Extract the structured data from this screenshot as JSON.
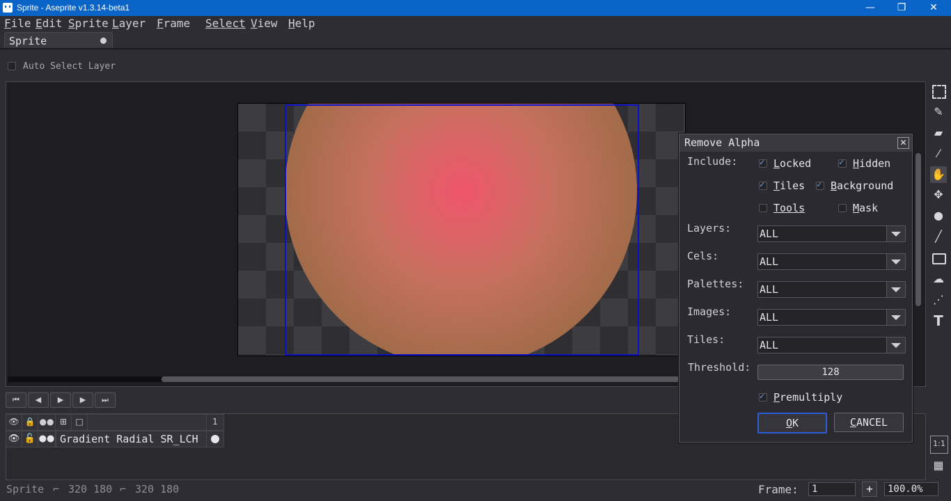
{
  "window": {
    "title": "Sprite - Aseprite v1.3.14-beta1",
    "minimize": "—",
    "maximize": "❐",
    "close": "✕"
  },
  "menu": [
    {
      "u": "F",
      "rest": "ile"
    },
    {
      "u": "E",
      "rest": "dit"
    },
    {
      "u": "S",
      "rest": "prite"
    },
    {
      "u": "L",
      "rest": "ayer"
    },
    {
      "u": "F",
      "rest": "rame"
    },
    {
      "u": "",
      "rest": "Select"
    },
    {
      "u": "V",
      "rest": "iew"
    },
    {
      "u": "H",
      "rest": "elp"
    }
  ],
  "tab": {
    "label": "Sprite"
  },
  "context": {
    "auto_select_label": "Auto Select Layer"
  },
  "tools": [
    "rectangular-marquee-icon",
    "pencil-icon",
    "eraser-icon",
    "eyedropper-icon",
    "hand-icon",
    "move-icon",
    "paint-bucket-icon",
    "line-icon",
    "rectangle-icon",
    "blur-icon",
    "spray-icon",
    "text-icon"
  ],
  "timeline": {
    "frame_header": "1",
    "layer_name": "Gradient Radial SR_LCH",
    "buttons": [
      "⏮",
      "◀",
      "▶",
      "▶",
      "⏭"
    ]
  },
  "status": {
    "sprite_label": "Sprite",
    "size_a": "320 180",
    "size_b": "320 180",
    "frame_label": "Frame:",
    "frame_value": "1",
    "plus": "+",
    "zoom": "100.0%"
  },
  "zoom_buttons": {
    "one_to_one": "1:1"
  },
  "dialog": {
    "title": "Remove Alpha",
    "close": "✕",
    "include_label": "Include:",
    "checks": [
      {
        "u": "L",
        "rest": "ocked",
        "checked": true
      },
      {
        "u": "H",
        "rest": "idden",
        "checked": true
      },
      {
        "u": "T",
        "rest": "iles",
        "checked": true
      },
      {
        "u": "B",
        "rest": "ackground",
        "checked": true
      },
      {
        "u": "",
        "rest": "Tools",
        "checked": false
      },
      {
        "u": "M",
        "rest": "ask",
        "checked": false
      }
    ],
    "layers_label": "Layers:",
    "layers_value": "ALL",
    "cels_label": "Cels:",
    "cels_value": "ALL",
    "palettes_label": "Palettes:",
    "palettes_value": "ALL",
    "images_label": "Images:",
    "images_value": "ALL",
    "tiles_label": "Tiles:",
    "tiles_value": "ALL",
    "threshold_label": "Threshold:",
    "threshold_value": "128",
    "premultiply": {
      "u": "P",
      "rest": "remultiply",
      "checked": true
    },
    "ok": {
      "u": "O",
      "rest": "K"
    },
    "cancel": {
      "u": "C",
      "rest": "ANCEL"
    }
  }
}
